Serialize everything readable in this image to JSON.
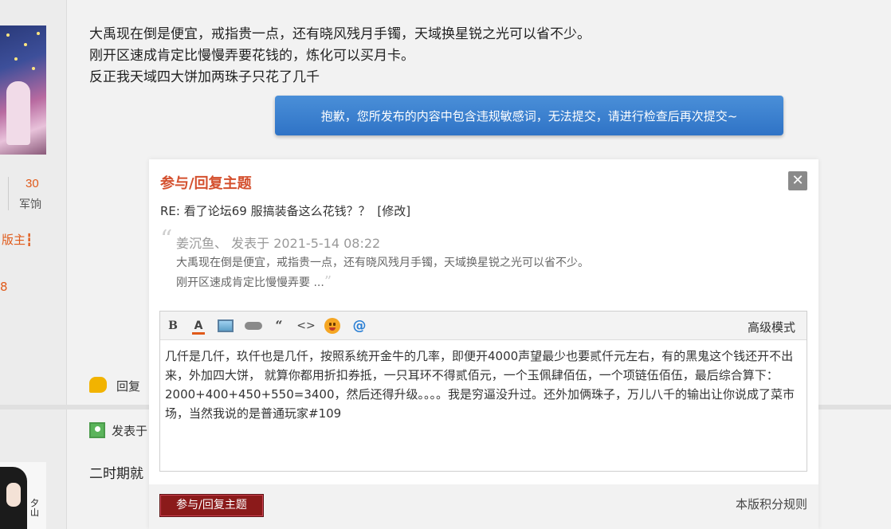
{
  "background": {
    "post_lines": [
      "大禹现在倒是便宜，戒指贵一点，还有晓风残月手镯，天域换星锐之光可以省不少。",
      "刚开区速成肯定比慢慢弄要花钱的，炼化可以买月卡。",
      "反正我天域四大饼加两珠子只花了几千"
    ],
    "stat_number": "30",
    "stat_label": "军饷",
    "moderator_label": "版主",
    "moderator_bar": "┇",
    "stat_8": "8",
    "reply_label": "回复",
    "posted_label": "发表于",
    "era_text": "二时期就",
    "avatar2_text": "夕山"
  },
  "notice": {
    "text": "抱歉，您所发布的内容中包含违规敏感词，无法提交，请进行检查后再次提交~"
  },
  "dialog": {
    "title": "参与/回复主题",
    "close_glyph": "✕",
    "subject": "RE: 看了论坛69 服搞装备这么花钱？？",
    "edit_label": "[修改]",
    "quote": {
      "open_mark": "“",
      "author": "姜沉鱼、",
      "posted_on": "发表于 2021-5-14 08:22",
      "line1": "大禹现在倒是便宜，戒指贵一点，还有晓风残月手镯，天域换星锐之光可以省不少。",
      "line2": "刚开区速成肯定比慢慢弄要 ...",
      "close_mark": "”"
    },
    "toolbar": {
      "bold": "B",
      "color": "A",
      "quote": "“",
      "code": "<>",
      "at": "@",
      "advanced_mode": "高级模式"
    },
    "message": "几仟是几仟，玖仟也是几仟，按照系统开金牛的几率，即便开4000声望最少也要贰仟元左右，有的黑鬼这个钱还开不出来，外加四大饼， 就算你都用折扣券抵，一只耳环不得贰佰元，一个玉佩肆佰伍，一个项链伍佰伍，最后综合算下：2000+400+450+550=3400，然后还得升级。。。。我是穷逼没升过。还外加俩珠子，万儿八千的输出让你说成了菜市场，当然我说的是普通玩家#109",
    "submit_label": "参与/回复主题",
    "rules_link": "本版积分规则"
  },
  "colors": {
    "accent": "#d4502e",
    "notice_bg": "#3a82d2",
    "submit_bg": "#8b1a1a"
  }
}
